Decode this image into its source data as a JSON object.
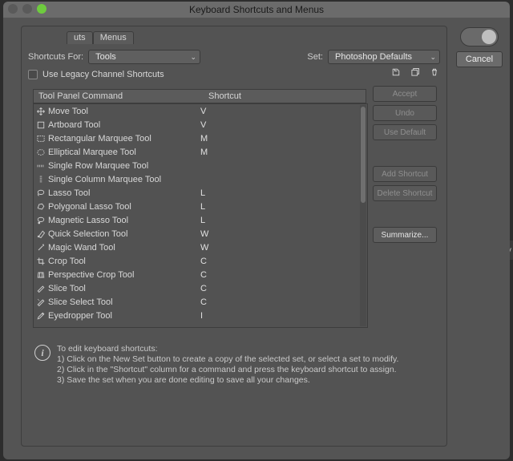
{
  "window": {
    "title": "Keyboard Shortcuts and Menus"
  },
  "tabs": {
    "t0": "uts",
    "t1": "Menus"
  },
  "row1": {
    "shortcuts_for": "Shortcuts For:",
    "shortcuts_for_value": "Tools",
    "set_label": "Set:",
    "set_value": "Photoshop Defaults"
  },
  "legacy": {
    "label": "Use Legacy Channel Shortcuts"
  },
  "headers": {
    "c1": "Tool Panel Command",
    "c2": "Shortcut"
  },
  "right": {
    "cancel": "Cancel"
  },
  "actions": {
    "accept": "Accept",
    "undo": "Undo",
    "use_default": "Use Default",
    "add_shortcut": "Add Shortcut",
    "delete_shortcut": "Delete Shortcut",
    "summarize": "Summarize..."
  },
  "tools": [
    {
      "icon": "move",
      "name": "Move Tool",
      "shortcut": "V"
    },
    {
      "icon": "artboard",
      "name": "Artboard Tool",
      "shortcut": "V"
    },
    {
      "icon": "rect-marq",
      "name": "Rectangular Marquee Tool",
      "shortcut": "M"
    },
    {
      "icon": "ell-marq",
      "name": "Elliptical Marquee Tool",
      "shortcut": "M"
    },
    {
      "icon": "row-marq",
      "name": "Single Row Marquee Tool",
      "shortcut": ""
    },
    {
      "icon": "col-marq",
      "name": "Single Column Marquee Tool",
      "shortcut": ""
    },
    {
      "icon": "lasso",
      "name": "Lasso Tool",
      "shortcut": "L"
    },
    {
      "icon": "poly-lasso",
      "name": "Polygonal Lasso Tool",
      "shortcut": "L"
    },
    {
      "icon": "mag-lasso",
      "name": "Magnetic Lasso Tool",
      "shortcut": "L"
    },
    {
      "icon": "quick-sel",
      "name": "Quick Selection Tool",
      "shortcut": "W"
    },
    {
      "icon": "wand",
      "name": "Magic Wand Tool",
      "shortcut": "W"
    },
    {
      "icon": "crop",
      "name": "Crop Tool",
      "shortcut": "C"
    },
    {
      "icon": "pcrop",
      "name": "Perspective Crop Tool",
      "shortcut": "C"
    },
    {
      "icon": "slice",
      "name": "Slice Tool",
      "shortcut": "C"
    },
    {
      "icon": "slice-sel",
      "name": "Slice Select Tool",
      "shortcut": "C"
    },
    {
      "icon": "eyedrop",
      "name": "Eyedropper Tool",
      "shortcut": "I"
    }
  ],
  "info": {
    "h": "To edit keyboard shortcuts:",
    "l1": "1) Click on the New Set button to create a copy of the selected set, or select a set to modify.",
    "l2": "2) Click in the \"Shortcut\" column for a command and press the keyboard shortcut to assign.",
    "l3": "3) Save the set when you are done editing to save all your changes."
  }
}
